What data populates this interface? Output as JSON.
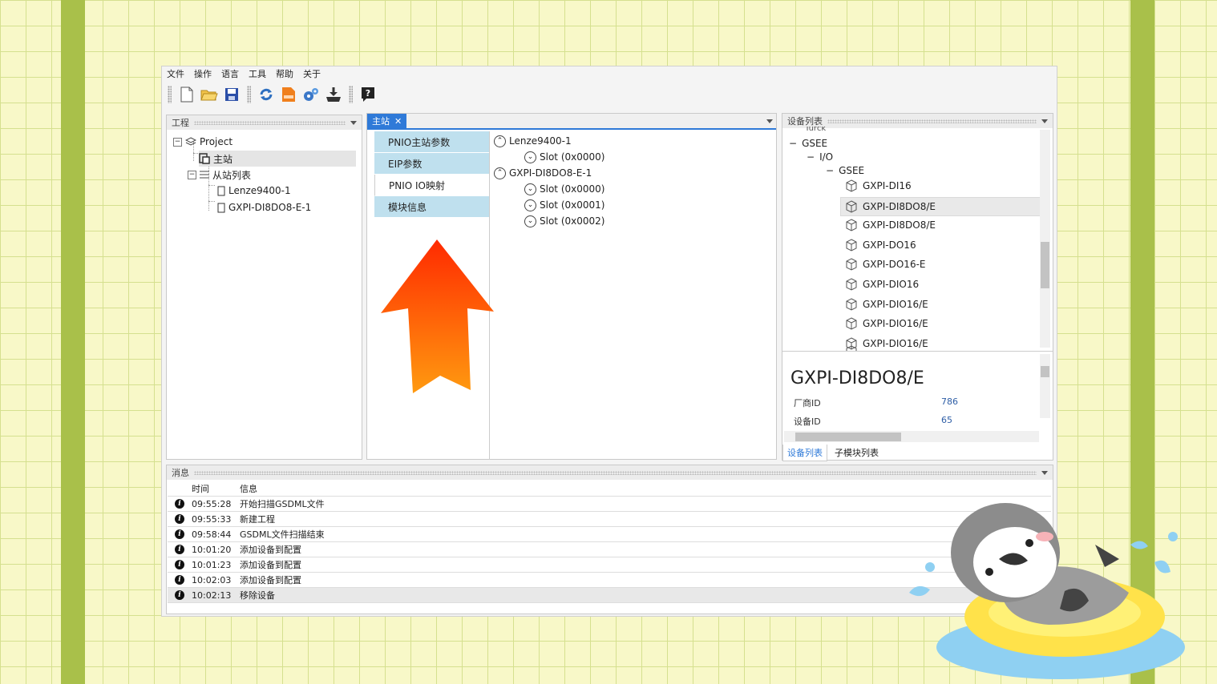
{
  "menu": [
    "文件",
    "操作",
    "语言",
    "工具",
    "帮助",
    "关于"
  ],
  "toolbar_icons": [
    "new-file-icon",
    "open-folder-icon",
    "save-icon",
    "refresh-icon",
    "export-icon",
    "settings-icon",
    "download-icon",
    "help-icon"
  ],
  "project_panel": {
    "title": "工程",
    "root": "Project",
    "master": "主站",
    "slave_list": "从站列表",
    "slaves": [
      "Lenze9400-1",
      "GXPI-DI8DO8-E-1"
    ]
  },
  "main_tab": {
    "tab_label": "主站",
    "side_tabs": [
      "PNIO主站参数",
      "EIP参数",
      "PNIO IO映射",
      "模块信息"
    ],
    "active_side_tab": "PNIO IO映射",
    "modules": [
      {
        "name": "Lenze9400-1",
        "slots": [
          "Slot (0x0000)"
        ]
      },
      {
        "name": "GXPI-DI8DO8-E-1",
        "slots": [
          "Slot (0x0000)",
          "Slot (0x0001)",
          "Slot (0x0002)"
        ]
      }
    ]
  },
  "device_panel": {
    "title": "设备列表",
    "cut_top": "Turck",
    "group1": "GSEE",
    "group2": "I/O",
    "group3": "GSEE",
    "devices": [
      "GXPI-DI16",
      "GXPI-DI8DO8/E",
      "GXPI-DI8DO8/E",
      "GXPI-DO16",
      "GXPI-DO16-E",
      "GXPI-DIO16",
      "GXPI-DIO16/E",
      "GXPI-DIO16/E",
      "GXPI-DIO16/E"
    ],
    "selected_index": 1,
    "detail_title": "GXPI-DI8DO8/E",
    "vendor_id_label": "厂商ID",
    "vendor_id": "786",
    "device_id_label": "设备ID",
    "device_id": "65",
    "tab_devices": "设备列表",
    "tab_submodules": "子模块列表"
  },
  "messages": {
    "title": "消息",
    "col_time": "时间",
    "col_info": "信息",
    "rows": [
      {
        "time": "09:55:28",
        "info": "开始扫描GSDML文件"
      },
      {
        "time": "09:55:33",
        "info": "新建工程"
      },
      {
        "time": "09:58:44",
        "info": "GSDML文件扫描结束"
      },
      {
        "time": "10:01:20",
        "info": "添加设备到配置"
      },
      {
        "time": "10:01:23",
        "info": "添加设备到配置"
      },
      {
        "time": "10:02:03",
        "info": "添加设备到配置"
      },
      {
        "time": "10:02:13",
        "info": "移除设备"
      }
    ]
  },
  "colors": {
    "accent": "#2f7ad8",
    "side_tab_bg": "#bfe0ee",
    "arrow_top": "#ff2a00",
    "arrow_bottom": "#ff9a10",
    "stripe": "#a9c04a"
  }
}
